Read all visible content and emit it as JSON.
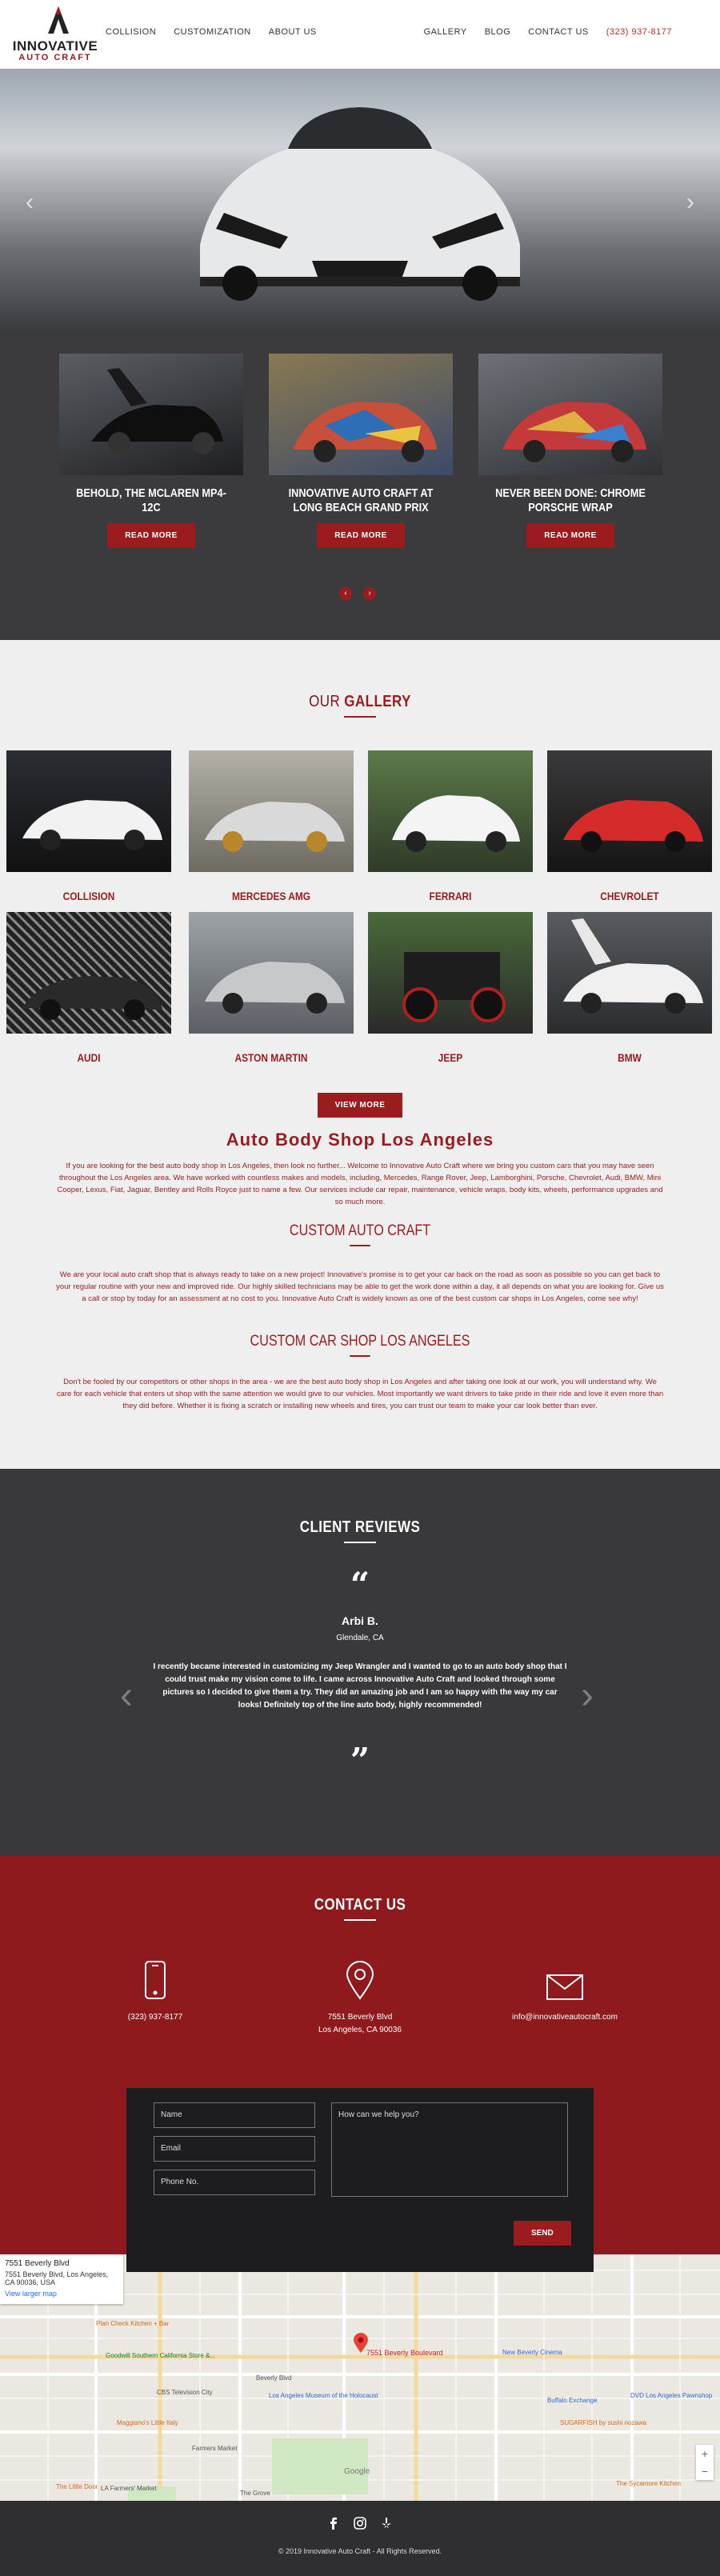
{
  "header": {
    "logo_line1": "INNOVATIVE",
    "logo_line2": "AUTO CRAFT",
    "nav_left": [
      "COLLISION",
      "CUSTOMIZATION",
      "ABOUT US"
    ],
    "nav_right": [
      "GALLERY",
      "BLOG",
      "CONTACT US"
    ],
    "phone": "(323) 937-8177"
  },
  "hero": {
    "prev_icon": "chevron-left-icon",
    "next_icon": "chevron-right-icon"
  },
  "news": {
    "cards": [
      {
        "title": "BEHOLD, THE MCLAREN MP4-12C",
        "button": "READ MORE"
      },
      {
        "title": "INNOVATIVE AUTO CRAFT AT LONG BEACH GRAND PRIX",
        "button": "READ MORE"
      },
      {
        "title": "NEVER BEEN DONE: CHROME PORSCHE WRAP",
        "button": "READ MORE"
      }
    ],
    "prev": "‹",
    "next": "›"
  },
  "gallery": {
    "heading_light": "OUR ",
    "heading_bold": "GALLERY",
    "items": [
      "COLLISION",
      "MERCEDES AMG",
      "FERRARI",
      "CHEVROLET",
      "AUDI",
      "ASTON MARTIN",
      "JEEP",
      "BMW"
    ],
    "view_more": "VIEW MORE"
  },
  "about": {
    "heading": "Auto Body Shop Los Angeles",
    "paragraph1": "If you are looking for the best auto body shop in Los Angeles, then look no further... Welcome to Innovative Auto Craft where we bring you custom cars that you may have seen throughout the Los Angeles area. We have worked with countless makes and models, including, Mercedes, Range Rover, Jeep, Lamborghini, Porsche, Chevrolet, Audi, BMW, Mini Cooper, Lexus, Fiat, Jaguar, Bentley and Rolls Royce just to name a few. Our services include car repair, maintenance, vehicle wraps, body kits, wheels, performance upgrades and so much more.",
    "sub1": "CUSTOM AUTO CRAFT",
    "paragraph2": "We are your local auto craft shop that is always ready to take on a new project! Innovative's promise is to get your car back on the road as soon as possible so you can get back to your regular routine with your new and improved ride. Our highly skilled technicians may be able to get the work done within a day, it all depends on what you are looking for. Give us a call or stop by today for an assessment at no cost to you. Innovative Auto Craft is widely known as one of the best custom car shops in Los Angeles, come see why!",
    "sub2": "CUSTOM CAR SHOP LOS ANGELES",
    "paragraph3": "Don't be fooled by our competitors or other shops in the area - we are the best auto body shop in Los Angeles and after taking one look at our work, you will understand why. We care for each vehicle that enters ut shop with the same attention we would give to our vehicles. Most importantly we want drivers to take pride in their ride and love it even more than they did before. Whether it is fixing a scratch or installing new wheels and tires, you can trust our team to make your car look better than ever."
  },
  "reviews": {
    "heading_light": "CLIENT ",
    "heading_bold": "REVIEWS",
    "open_quote": "“",
    "close_quote": "”",
    "name": "Arbi B.",
    "location": "Glendale, CA",
    "text": "I recently became interested in customizing my Jeep Wrangler and I wanted to go to an auto body shop that I could trust make my vision come to life. I came across Innovative Auto Craft and looked through some pictures so I decided to give them a try. They did an amazing job and I am so happy with the way my car looks! Definitely top of the line auto body, highly recommended!",
    "prev": "‹",
    "next": "›"
  },
  "contact": {
    "heading_light": "CONTACT ",
    "heading_bold": "US",
    "phone": "(323) 937-8177",
    "address_line1": "7551 Beverly Blvd",
    "address_line2": "Los Angeles, CA 90036",
    "email": "info@innovativeautocraft.com",
    "form": {
      "name_placeholder": "Name",
      "email_placeholder": "Email",
      "phone_placeholder": "Phone No.",
      "message_placeholder": "How can we help you?",
      "send": "SEND"
    }
  },
  "map": {
    "card_title": "7551 Beverly Blvd",
    "card_address": "7551 Beverly Blvd, Los Angeles, CA 90036, USA",
    "card_link": "View larger map",
    "pin_label": "7551 Beverly Boulevard",
    "labels": {
      "plan_check": "Plan Check Kitchen + Bar",
      "goodwill": "Goodwill Southern California Store &...",
      "cbs": "CBS Television City",
      "maggianos": "Maggiano's Little Italy",
      "farmers_market": "Farmers Market",
      "museum": "Los Angeles Museum of the Holocaust",
      "new_beverly": "New Beverly Cinema",
      "buffalo": "Buffalo Exchange",
      "dvd": "DVD Los Angeles Pawnshop",
      "sugarfish": "SUGARFISH by sushi nozawa",
      "little_door": "The Little Door",
      "sycamore": "The Sycamore Kitchen",
      "la_farmers": "LA Farmers' Market",
      "grove": "The Grove",
      "beverly_blvd": "Beverly Blvd",
      "google": "Google"
    },
    "zoom_in": "+",
    "zoom_out": "−"
  },
  "footer": {
    "copyright": "© 2019 Innovative Auto Craft - All Rights Reserved.",
    "social": [
      "facebook-icon",
      "instagram-icon",
      "yelp-icon"
    ]
  },
  "colors": {
    "accent": "#9b1b1f",
    "dark": "#39393b",
    "contact_bg": "#8e1a1e"
  }
}
